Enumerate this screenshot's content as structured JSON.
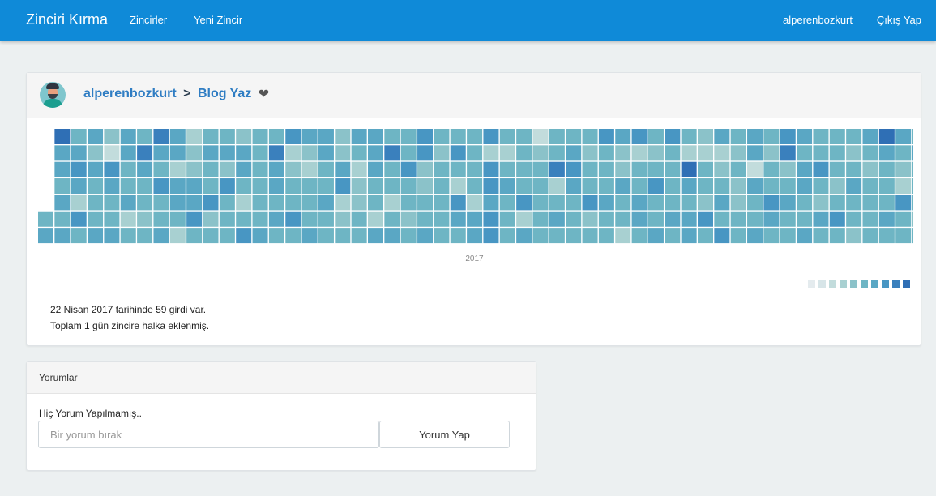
{
  "navbar": {
    "brand": "Zinciri Kırma",
    "links": [
      "Zincirler",
      "Yeni Zincir"
    ],
    "username": "alperenbozkurt",
    "logout": "Çıkış Yap"
  },
  "chain": {
    "owner": "alperenbozkurt",
    "separator": ">",
    "title": "Blog Yaz",
    "heart_icon": "heart-icon",
    "avatar_icon": "avatar-person-icon",
    "year_label": "2017",
    "info_line1": "22 Nisan 2017 tarihinde 59 girdi var.",
    "info_line2": "Toplam 1 gün zincire halka eklenmiş.",
    "heatmap_colors": [
      "#e4ebee",
      "#d7e5e8",
      "#c2dcdc",
      "#a8d0d1",
      "#8bc2c9",
      "#6eb5c4",
      "#5aa7c4",
      "#4896c3",
      "#3a80bd",
      "#2f6fb5"
    ],
    "heatmap_levels": [
      [
        9,
        5,
        6,
        4,
        6,
        5,
        8,
        6,
        3,
        5,
        5,
        4,
        5,
        5,
        7,
        6,
        6,
        4,
        6,
        6,
        5,
        5,
        7,
        5,
        5,
        5,
        7,
        5,
        5,
        2,
        5,
        5,
        5,
        7,
        6,
        7,
        5,
        7,
        5,
        4,
        6,
        5,
        6,
        5,
        7,
        6,
        5,
        5,
        5,
        6,
        9,
        6,
        5
      ],
      [
        6,
        6,
        4,
        2,
        6,
        8,
        6,
        6,
        4,
        6,
        6,
        6,
        5,
        8,
        3,
        4,
        6,
        4,
        5,
        6,
        8,
        5,
        7,
        4,
        7,
        5,
        3,
        3,
        5,
        4,
        5,
        6,
        4,
        5,
        4,
        3,
        4,
        5,
        3,
        3,
        3,
        4,
        6,
        4,
        8,
        5,
        5,
        5,
        4,
        5,
        6,
        5,
        6
      ],
      [
        6,
        7,
        6,
        7,
        5,
        6,
        5,
        3,
        4,
        5,
        4,
        6,
        5,
        6,
        4,
        3,
        5,
        6,
        3,
        6,
        5,
        7,
        4,
        5,
        5,
        5,
        7,
        5,
        5,
        5,
        8,
        7,
        5,
        5,
        4,
        5,
        5,
        5,
        9,
        5,
        4,
        5,
        2,
        5,
        4,
        6,
        7,
        5,
        5,
        4,
        5,
        4,
        5
      ],
      [
        5,
        6,
        5,
        6,
        5,
        5,
        7,
        6,
        6,
        5,
        7,
        5,
        5,
        6,
        5,
        5,
        5,
        7,
        4,
        5,
        5,
        5,
        4,
        5,
        3,
        5,
        7,
        6,
        5,
        5,
        3,
        6,
        5,
        5,
        6,
        5,
        7,
        5,
        6,
        5,
        5,
        4,
        6,
        5,
        5,
        6,
        5,
        4,
        6,
        5,
        5,
        3,
        5
      ],
      [
        6,
        3,
        5,
        5,
        6,
        5,
        5,
        6,
        6,
        7,
        5,
        3,
        5,
        5,
        5,
        5,
        6,
        3,
        4,
        5,
        3,
        5,
        5,
        5,
        7,
        3,
        6,
        5,
        7,
        5,
        5,
        5,
        7,
        6,
        5,
        6,
        5,
        5,
        5,
        4,
        6,
        4,
        5,
        7,
        6,
        5,
        4,
        5,
        5,
        5,
        5,
        7,
        5
      ],
      [
        5,
        7,
        5,
        5,
        3,
        4,
        5,
        5,
        7,
        4,
        5,
        5,
        5,
        6,
        7,
        5,
        5,
        4,
        5,
        3,
        5,
        4,
        5,
        5,
        6,
        6,
        7,
        5,
        3,
        5,
        6,
        5,
        4,
        5,
        5,
        6,
        5,
        6,
        6,
        7,
        5,
        5,
        5,
        6,
        5,
        5,
        6,
        7,
        5,
        5,
        6,
        5,
        4
      ],
      [
        6,
        5,
        6,
        6,
        5,
        5,
        6,
        3,
        5,
        5,
        5,
        7,
        6,
        5,
        5,
        6,
        5,
        5,
        5,
        6,
        6,
        5,
        6,
        5,
        5,
        6,
        7,
        5,
        6,
        5,
        5,
        5,
        5,
        5,
        3,
        5,
        6,
        5,
        6,
        5,
        7,
        5,
        6,
        5,
        5,
        6,
        5,
        5,
        4,
        5,
        5,
        5,
        5
      ]
    ]
  },
  "comments": {
    "title": "Yorumlar",
    "empty_text": "Hiç Yorum Yapılmamış..",
    "input_placeholder": "Bir yorum bırak",
    "submit_label": "Yorum Yap"
  }
}
